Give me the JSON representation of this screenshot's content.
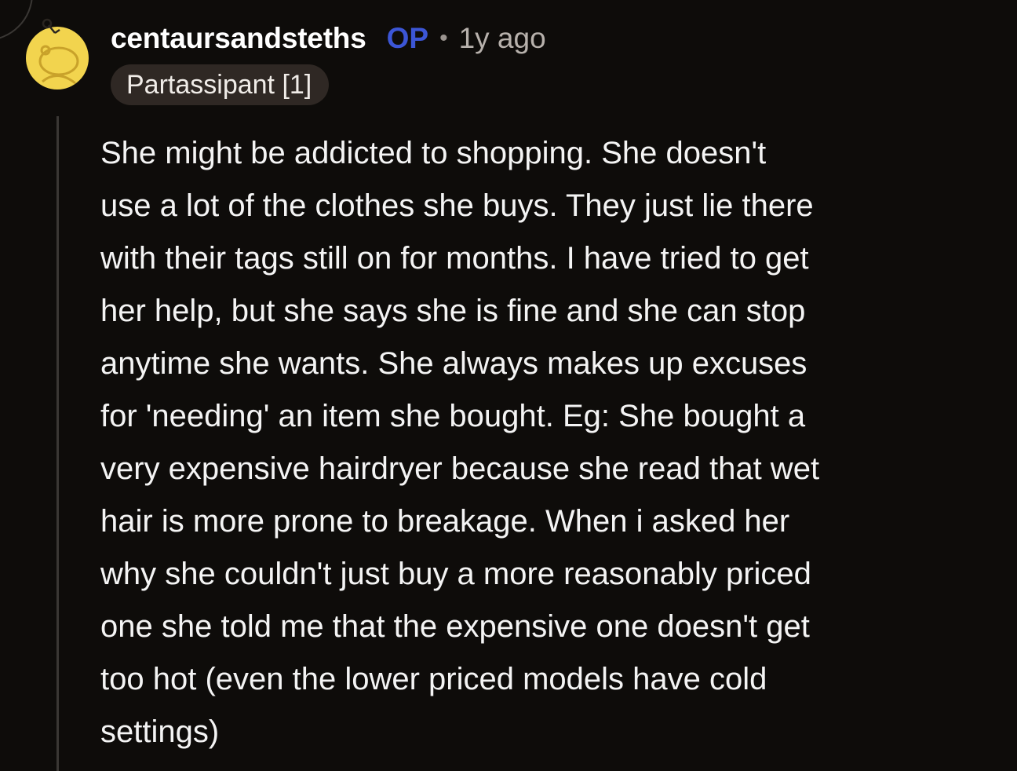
{
  "comment": {
    "author": {
      "username": "centaursandsteths",
      "op_badge": "OP",
      "separator": "•",
      "time_ago": "1y ago",
      "flair": "Partassipant [1]",
      "avatar_icon": "snoo-avatar-icon"
    },
    "body_lines": [
      "She might be addicted to shopping. She doesn't",
      "use a lot of the clothes she buys. They just lie there",
      "with their tags still on for months. I have tried to get",
      "her help, but she says she is fine and she can stop",
      "anytime she wants. She always makes up excuses",
      "for 'needing' an item she bought. Eg: She bought a",
      "very expensive hairdryer because she read that wet",
      "hair is more prone to breakage. When i asked her",
      "why she couldn't just buy a more reasonably priced",
      "one she told me that the expensive one doesn't get",
      "too hot (even the lower priced models have cold",
      "settings)"
    ]
  },
  "colors": {
    "background": "#0e0c0a",
    "op_badge": "#3c56d6",
    "flair_bg": "#2f2824",
    "avatar_bg": "#f2d44e"
  }
}
